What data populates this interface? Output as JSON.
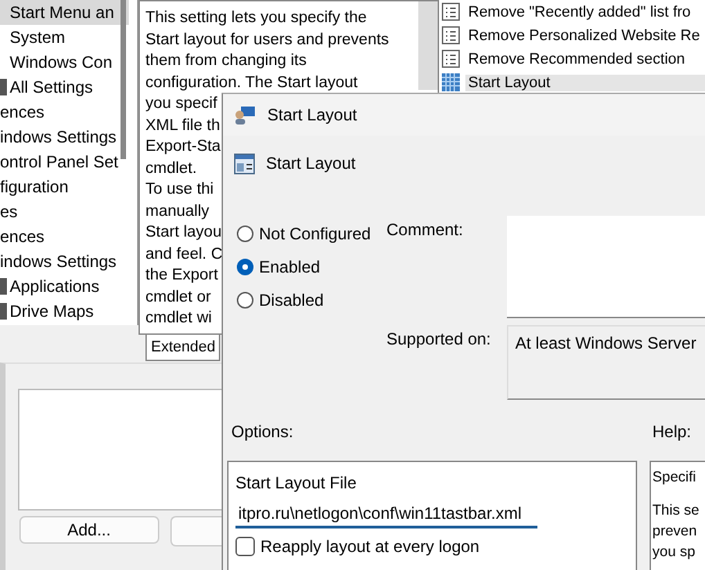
{
  "tree": {
    "items": [
      {
        "label": "Start Menu an",
        "selected": true,
        "kind": "plain"
      },
      {
        "label": "System",
        "selected": false,
        "kind": "plain"
      },
      {
        "label": "Windows Con",
        "selected": false,
        "kind": "plain"
      },
      {
        "label": "All Settings",
        "selected": false,
        "kind": "iconed"
      },
      {
        "label": "ences",
        "selected": false,
        "kind": "edge"
      },
      {
        "label": "indows Settings",
        "selected": false,
        "kind": "edge"
      },
      {
        "label": "ontrol Panel Set",
        "selected": false,
        "kind": "edge"
      },
      {
        "label": "figuration",
        "selected": false,
        "kind": "edge"
      },
      {
        "label": "es",
        "selected": false,
        "kind": "edge"
      },
      {
        "label": "ences",
        "selected": false,
        "kind": "edge"
      },
      {
        "label": "indows Settings",
        "selected": false,
        "kind": "edge"
      },
      {
        "label": "Applications",
        "selected": false,
        "kind": "iconed"
      },
      {
        "label": "Drive Maps",
        "selected": false,
        "kind": "iconed"
      }
    ]
  },
  "description": {
    "lines": [
      "This setting lets you specify the",
      "Start layout for users and prevents",
      "them from changing its",
      "configuration. The Start layout",
      "you specif",
      "XML file th",
      "Export-Sta",
      "cmdlet.",
      "To use thi",
      "manually",
      "Start layou",
      "and feel. C",
      "the Export",
      "cmdlet or",
      "cmdlet wi"
    ],
    "tab": "Extended"
  },
  "settings_list": {
    "items": [
      {
        "label": "Remove \"Recently added\" list fro",
        "selected": false
      },
      {
        "label": "Remove Personalized Website Re",
        "selected": false
      },
      {
        "label": "Remove Recommended section",
        "selected": false
      },
      {
        "label": "Start Layout",
        "selected": true
      }
    ]
  },
  "lower_panel": {
    "buttons": [
      "Add..."
    ]
  },
  "dialog": {
    "title": "Start Layout",
    "header": "Start Layout",
    "states": [
      {
        "label": "Not Configured",
        "selected": false
      },
      {
        "label": "Enabled",
        "selected": true
      },
      {
        "label": "Disabled",
        "selected": false
      }
    ],
    "comment_label": "Comment:",
    "supported_label": "Supported on:",
    "supported_value": "At least Windows Server",
    "options_label": "Options:",
    "help_label": "Help:",
    "options": {
      "field_label": "Start Layout File",
      "field_value": "itpro.ru\\netlogon\\conf\\win11tastbar.xml",
      "checkbox": {
        "label": "Reapply layout at every logon",
        "checked": false
      }
    },
    "help_lines": [
      "Specifi",
      "This se",
      "preven",
      "you sp"
    ]
  }
}
